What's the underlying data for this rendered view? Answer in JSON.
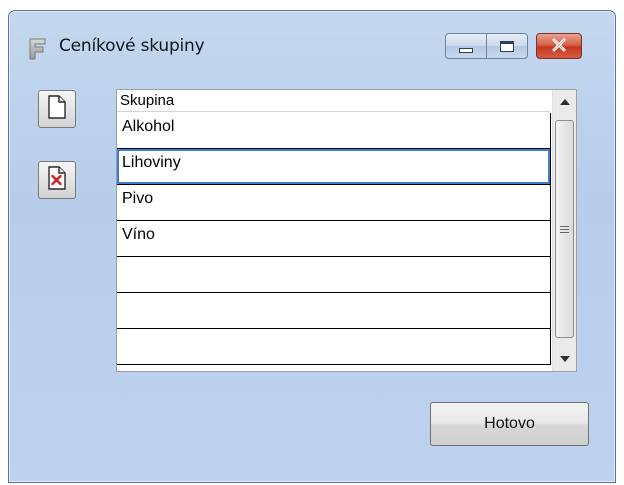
{
  "window": {
    "title": "Ceníkové skupiny",
    "app_icon": "app-f-icon",
    "title_buttons": [
      "minimize-icon",
      "maximize-icon",
      "close-icon"
    ]
  },
  "toolbar": {
    "new_icon": "new-document-icon",
    "delete_icon": "delete-document-icon"
  },
  "grid": {
    "column_header": "Skupina",
    "rows": [
      "Alkohol",
      "Lihoviny",
      "Pivo",
      "Víno",
      "",
      "",
      ""
    ],
    "selected_index": 1
  },
  "footer": {
    "done_label": "Hotovo"
  },
  "colors": {
    "window_bg": "#bcd2ee",
    "close_red": "#c5381f",
    "selection_border": "#3c7fd1"
  }
}
